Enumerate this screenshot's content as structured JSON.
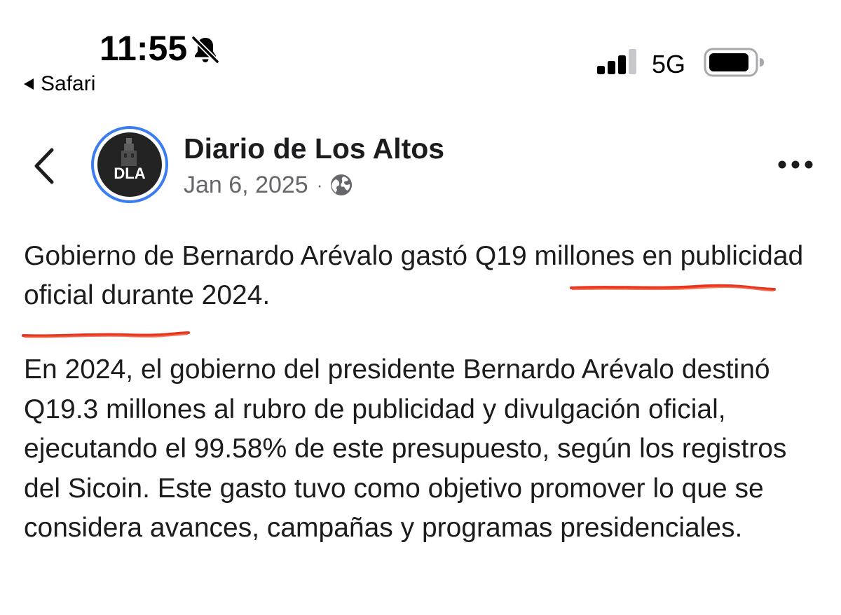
{
  "status_bar": {
    "time": "11:55",
    "bell_icon": "bell-slash-icon",
    "back_app_label": "Safari",
    "signal_icon": "cellular-signal-icon",
    "signal_bars_active": 3,
    "signal_bars_total": 4,
    "network": "5G",
    "battery_icon": "battery-icon",
    "battery_level": 0.9
  },
  "post": {
    "back_icon": "chevron-left-icon",
    "avatar_text": "DLA",
    "page_name": "Diario de Los Altos",
    "date": "Jan 6, 2025",
    "separator": "·",
    "audience_icon": "globe-icon",
    "more_icon": "more-horizontal-icon",
    "title": "Gobierno de Bernardo Arévalo gastó Q19 millones en publicidad oficial durante 2024.",
    "body": "En 2024, el gobierno del presidente Bernardo Arévalo destinó Q19.3 millones al rubro de publicidad y divulgación oficial, ejecutando el 99.58% de este presupuesto, según los registros del Sicoin. Este gasto tuvo como objetivo promover lo que se considera avances, campañas y programas presidenciales."
  },
  "colors": {
    "avatar_ring": "#3b7cf0",
    "underline": "#e8341c",
    "meta_text": "#65676b"
  }
}
